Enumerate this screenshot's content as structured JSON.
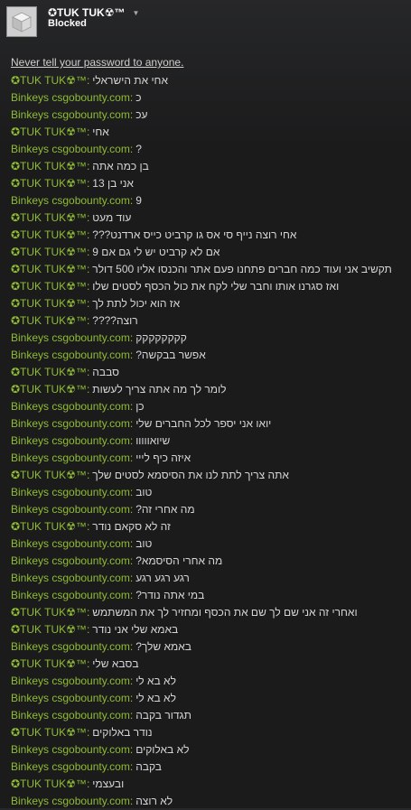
{
  "header": {
    "name": "✪TUK TUK☢™",
    "status": "Blocked"
  },
  "warning": "Never tell your password to anyone.",
  "senders": {
    "tuk": "✪TUK TUK☢™",
    "bin": "Binkeys csgobounty.com"
  },
  "colors": {
    "sender": "#8fbc34",
    "text": "#d5d5d5",
    "background": "#1b1b1c"
  },
  "messages": [
    {
      "from": "tuk",
      "text": "אחי את הישראלי"
    },
    {
      "from": "bin",
      "text": "כ"
    },
    {
      "from": "bin",
      "text": "עכ"
    },
    {
      "from": "tuk",
      "text": "אחי"
    },
    {
      "from": "bin",
      "text": "?"
    },
    {
      "from": "tuk",
      "text": "בן כמה אתה"
    },
    {
      "from": "tuk",
      "text": "אני בן 13"
    },
    {
      "from": "bin",
      "text": "9"
    },
    {
      "from": "tuk",
      "text": "עוד מעט"
    },
    {
      "from": "tuk",
      "text": "אחי רוצה נייף סי אס גו קרביט כייס ארדנט???"
    },
    {
      "from": "tuk",
      "text": "אם לא קרביט יש לי גם אם 9"
    },
    {
      "from": "tuk",
      "text": "תקשיב אני ועוד כמה חברים פתחנו פעם אתר והכנסו אליו 500 דולר"
    },
    {
      "from": "tuk",
      "text": "ואז סגרנו אותו וחבר שלי לקח את כול הכסף לסטים שלו"
    },
    {
      "from": "tuk",
      "text": "אז הוא יכול לתת לך"
    },
    {
      "from": "tuk",
      "text": "רוצה????"
    },
    {
      "from": "bin",
      "text": "קקקקקקקק"
    },
    {
      "from": "bin",
      "text": "אפשר בבקשה?"
    },
    {
      "from": "tuk",
      "text": "סבבה"
    },
    {
      "from": "tuk",
      "text": "לומר לך מה אתה צריך לעשות"
    },
    {
      "from": "bin",
      "text": "כן"
    },
    {
      "from": "bin",
      "text": "יואו אני יספר לכל החברים שלי"
    },
    {
      "from": "bin",
      "text": "שיואווווו"
    },
    {
      "from": "bin",
      "text": "איזה כיף לייי"
    },
    {
      "from": "tuk",
      "text": "אתה צריך לתת לנו את הסיסמא לסטים שלך"
    },
    {
      "from": "bin",
      "text": "טוב"
    },
    {
      "from": "bin",
      "text": "מה אחרי זה?"
    },
    {
      "from": "tuk",
      "text": "זה לא סקאם נודר"
    },
    {
      "from": "bin",
      "text": "טוב"
    },
    {
      "from": "bin",
      "text": "מה אחרי הסיסמא?"
    },
    {
      "from": "bin",
      "text": "רגע רגע רגע"
    },
    {
      "from": "bin",
      "text": "במי אתה נודר?"
    },
    {
      "from": "tuk",
      "text": "ואחרי זה אני שם לך שם את הכסף ומחזיר לך את המשתמש"
    },
    {
      "from": "tuk",
      "text": "באמא שלי אני נודר"
    },
    {
      "from": "bin",
      "text": "באמא שלך?"
    },
    {
      "from": "tuk",
      "text": "בסבא שלי"
    },
    {
      "from": "bin",
      "text": "לא בא לי"
    },
    {
      "from": "bin",
      "text": "לא בא לי"
    },
    {
      "from": "bin",
      "text": "תגדור בקבה"
    },
    {
      "from": "tuk",
      "text": "נודר באלוקים"
    },
    {
      "from": "bin",
      "text": "לא באלוקים"
    },
    {
      "from": "bin",
      "text": "בקבה"
    },
    {
      "from": "tuk",
      "text": "ובעצמי"
    },
    {
      "from": "bin",
      "text": "לא רוצה"
    }
  ]
}
